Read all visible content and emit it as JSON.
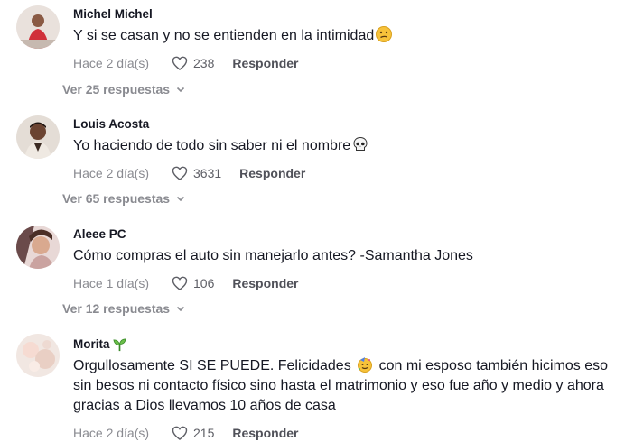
{
  "comments": [
    {
      "username": "Michel Michel",
      "text": "Y si se casan y no se entienden en la intimidad",
      "emoji": "confused-face-emoji",
      "date": "Hace 2 día(s)",
      "likes": "238",
      "reply_label": "Responder",
      "view_replies": "Ver 25 respuestas"
    },
    {
      "username": "Louis Acosta",
      "text": "Yo haciendo de todo sin saber ni el nombre",
      "emoji": "skull-emoji",
      "date": "Hace 2 día(s)",
      "likes": "3631",
      "reply_label": "Responder",
      "view_replies": "Ver 65 respuestas"
    },
    {
      "username": "Aleee PC",
      "text": "Cómo compras el auto sin manejarlo antes? -Samantha Jones",
      "date": "Hace 1 día(s)",
      "likes": "106",
      "reply_label": "Responder",
      "view_replies": "Ver 12 respuestas"
    },
    {
      "username": "Morita",
      "username_emoji": "seedling-emoji",
      "text_part1": "Orgullosamente SI SE PUEDE. Felicidades",
      "text_emoji": "partying-face-emoji",
      "text_part2": "con mi esposo también hicimos eso sin besos ni contacto físico sino hasta el matrimonio y eso fue año y medio y ahora gracias a Dios llevamos 10 años de casa",
      "date": "Hace 2 día(s)",
      "likes": "215",
      "reply_label": "Responder"
    }
  ],
  "colors": {
    "text": "#161823",
    "muted": "#8a8b91",
    "reply": "#505159"
  }
}
